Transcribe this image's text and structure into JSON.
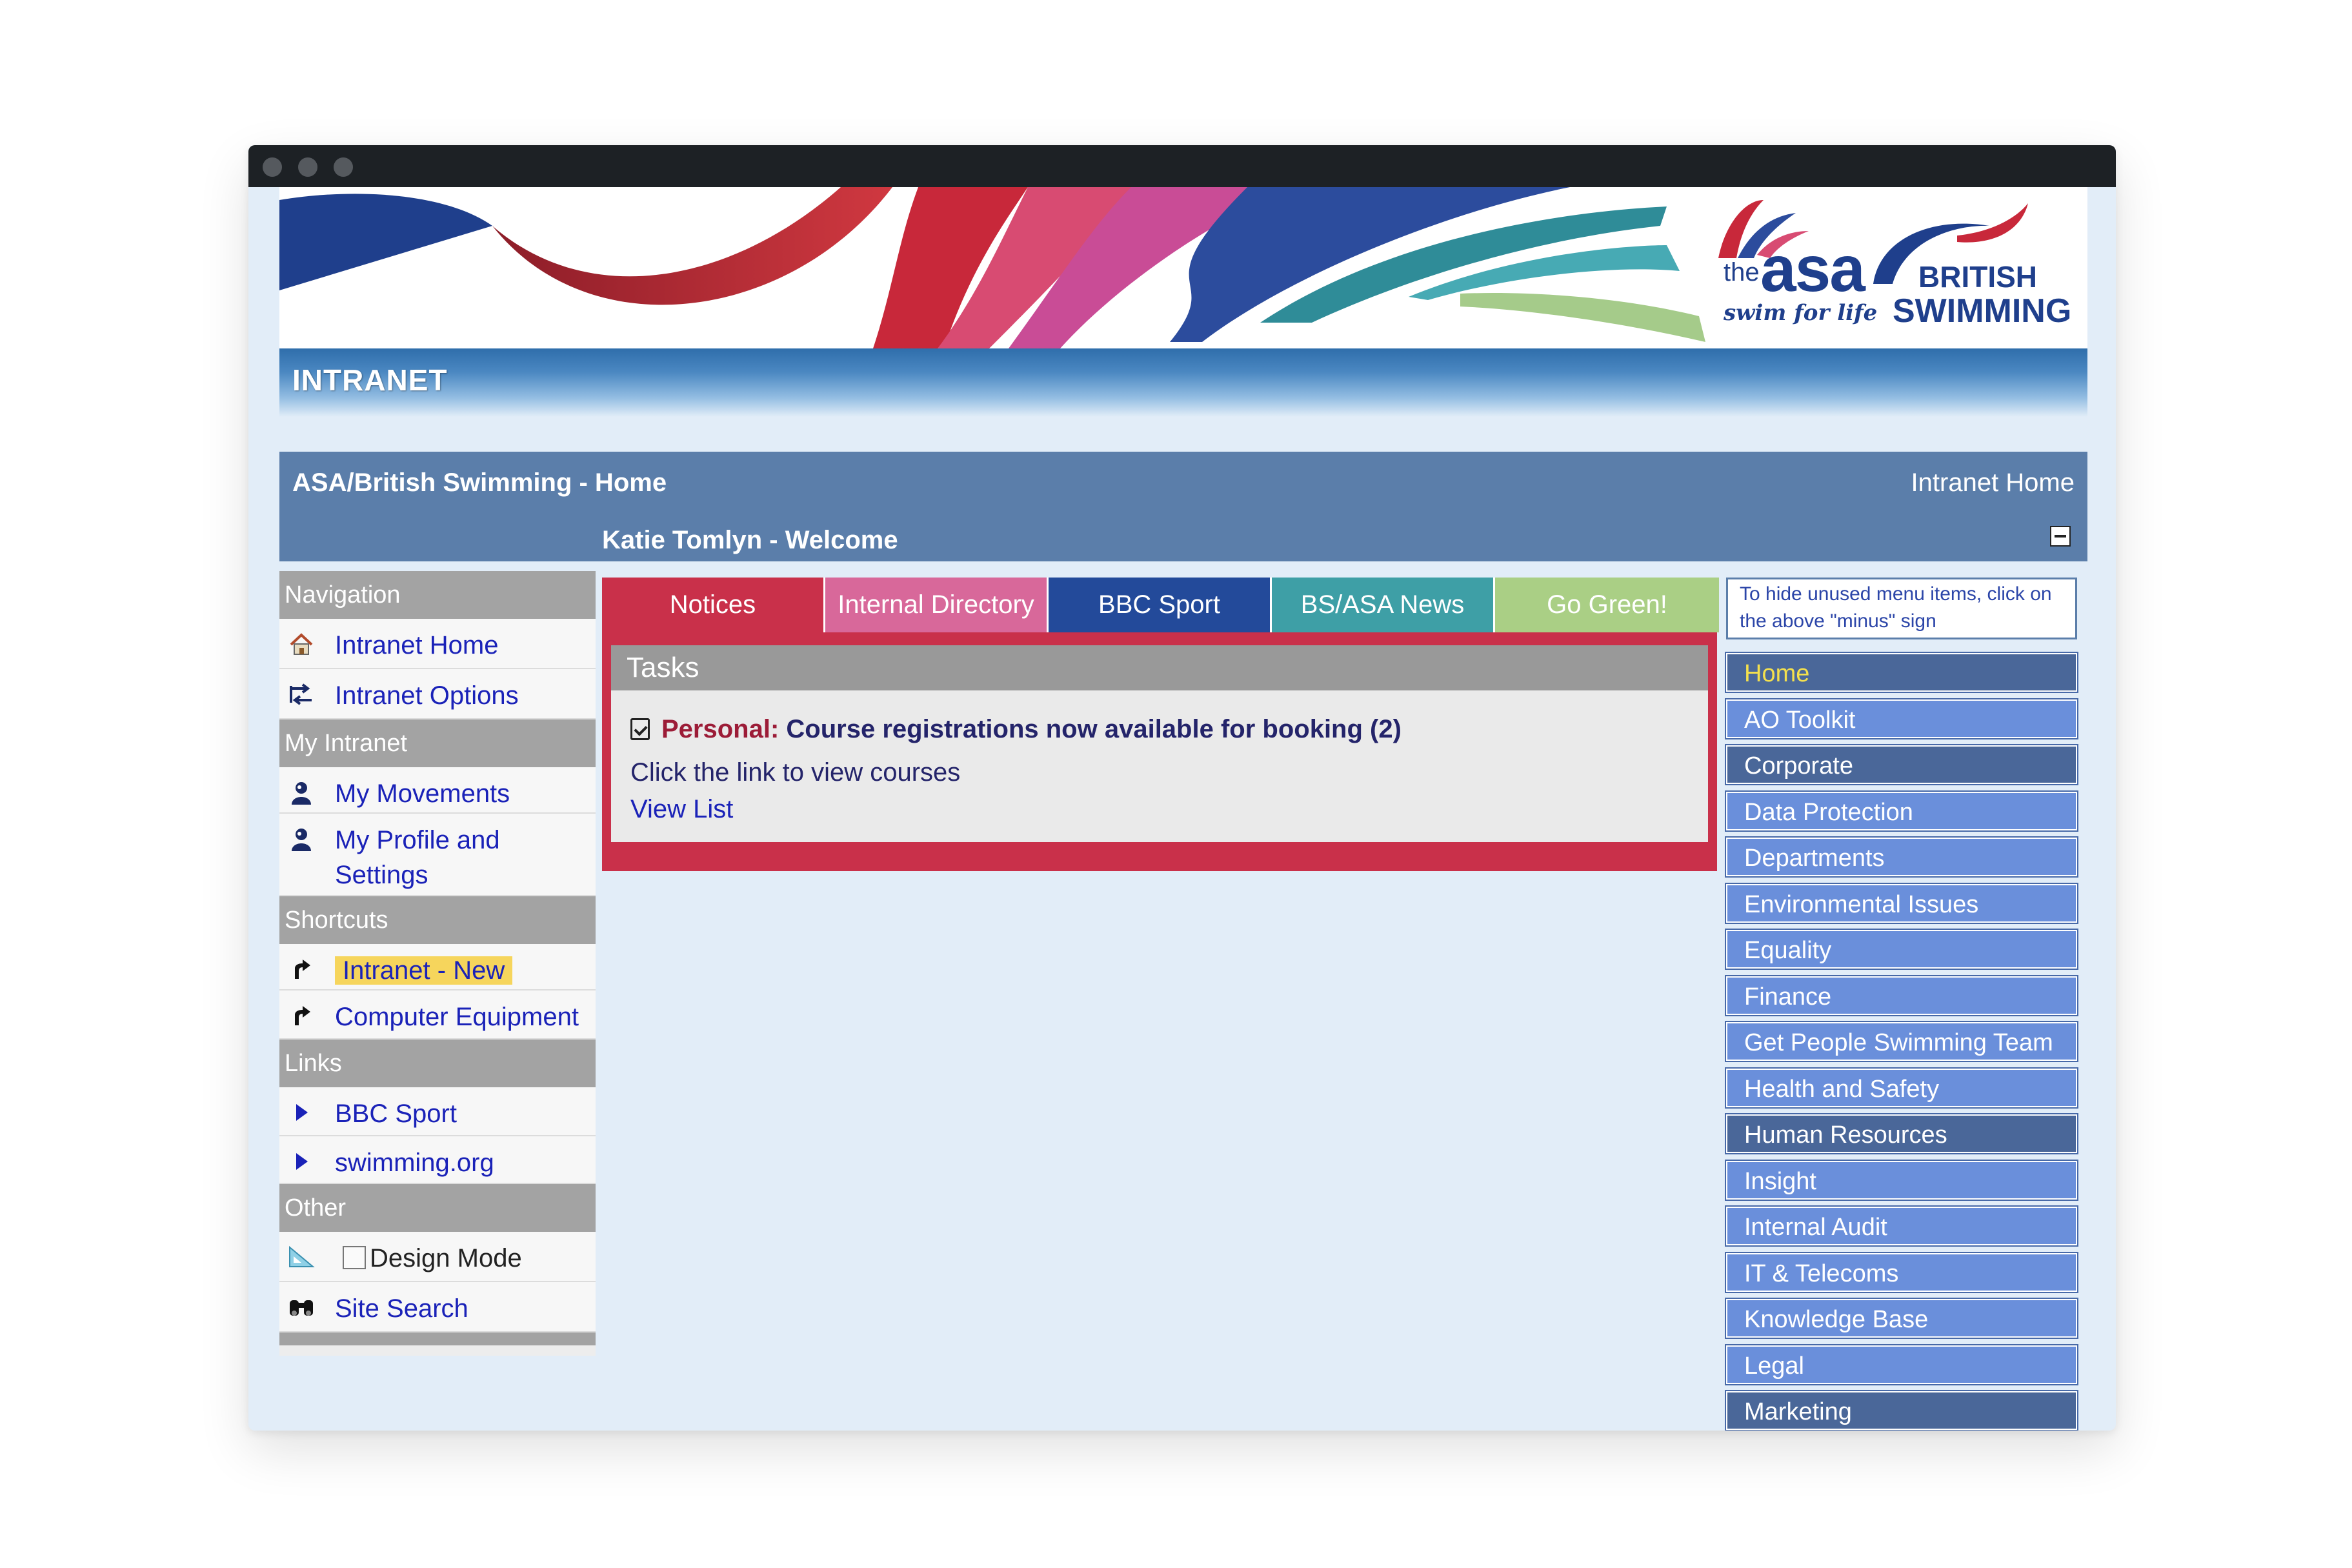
{
  "window": {
    "dots": [
      "close",
      "minimize",
      "maximize"
    ]
  },
  "banner": {
    "title": "INTRANET",
    "logo_asa_the": "the",
    "logo_asa_name": "asa",
    "logo_asa_tagline": "swim for life",
    "logo_bs_line1": "BRITISH",
    "logo_bs_line2": "SWIMMING"
  },
  "header": {
    "site_title": "ASA/British Swimming - Home",
    "home_link": "Intranet Home",
    "welcome": "Katie Tomlyn - Welcome"
  },
  "leftnav": {
    "sections": [
      {
        "title": "Navigation",
        "items": [
          {
            "label": "Intranet Home",
            "icon": "house-icon"
          },
          {
            "label": "Intranet Options",
            "icon": "options-icon"
          }
        ]
      },
      {
        "title": "My Intranet",
        "items": [
          {
            "label": "My Movements",
            "icon": "person-icon"
          },
          {
            "label": "My Profile and Settings",
            "icon": "person-icon"
          }
        ]
      },
      {
        "title": "Shortcuts",
        "items": [
          {
            "label": "Intranet - New",
            "icon": "shortcut-arrow-icon",
            "highlighted": true
          },
          {
            "label": "Computer Equipment",
            "icon": "shortcut-arrow-icon"
          }
        ]
      },
      {
        "title": "Links",
        "items": [
          {
            "label": "BBC Sport",
            "icon": "triangle-right-icon"
          },
          {
            "label": "swimming.org",
            "icon": "triangle-right-icon"
          }
        ]
      },
      {
        "title": "Other",
        "items": [
          {
            "label": "Design Mode",
            "icon": "set-square-icon",
            "checkbox": false
          },
          {
            "label": "Site Search",
            "icon": "binoculars-icon"
          }
        ]
      }
    ]
  },
  "tabs": [
    {
      "label": "Notices",
      "color": "#c9304a",
      "active": true
    },
    {
      "label": "Internal Directory",
      "color": "#d8689a"
    },
    {
      "label": "BBC Sport",
      "color": "#234a9a"
    },
    {
      "label": "BS/ASA News",
      "color": "#3e9fa6"
    },
    {
      "label": "Go Green!",
      "color": "#aacf85"
    }
  ],
  "tasks": {
    "heading": "Tasks",
    "personal_label": "Personal:",
    "title": "Course registrations now available for booking (2)",
    "description": "Click the link to view courses",
    "link": "View List"
  },
  "rightmenu": {
    "hint": "To hide unused menu items, click on the above \"minus\" sign",
    "items": [
      {
        "label": "Home",
        "style": "home"
      },
      {
        "label": "AO Toolkit",
        "style": "light"
      },
      {
        "label": "Corporate",
        "style": "dark"
      },
      {
        "label": "Data Protection",
        "style": "light"
      },
      {
        "label": "Departments",
        "style": "light"
      },
      {
        "label": "Environmental Issues",
        "style": "light"
      },
      {
        "label": "Equality",
        "style": "light"
      },
      {
        "label": "Finance",
        "style": "light"
      },
      {
        "label": "Get People Swimming Team",
        "style": "light"
      },
      {
        "label": "Health and Safety",
        "style": "light"
      },
      {
        "label": "Human Resources",
        "style": "dark"
      },
      {
        "label": "Insight",
        "style": "light"
      },
      {
        "label": "Internal Audit",
        "style": "light"
      },
      {
        "label": "IT & Telecoms",
        "style": "light"
      },
      {
        "label": "Knowledge Base",
        "style": "light"
      },
      {
        "label": "Legal",
        "style": "light"
      },
      {
        "label": "Marketing",
        "style": "dark"
      }
    ]
  },
  "colors": {
    "header_blue": "#5b7eaa",
    "menu_light": "#6a8fdb",
    "menu_dark": "#4a6799",
    "home_text": "#f4e04d",
    "link_blue": "#1a22b8",
    "notices_red": "#c9304a"
  }
}
